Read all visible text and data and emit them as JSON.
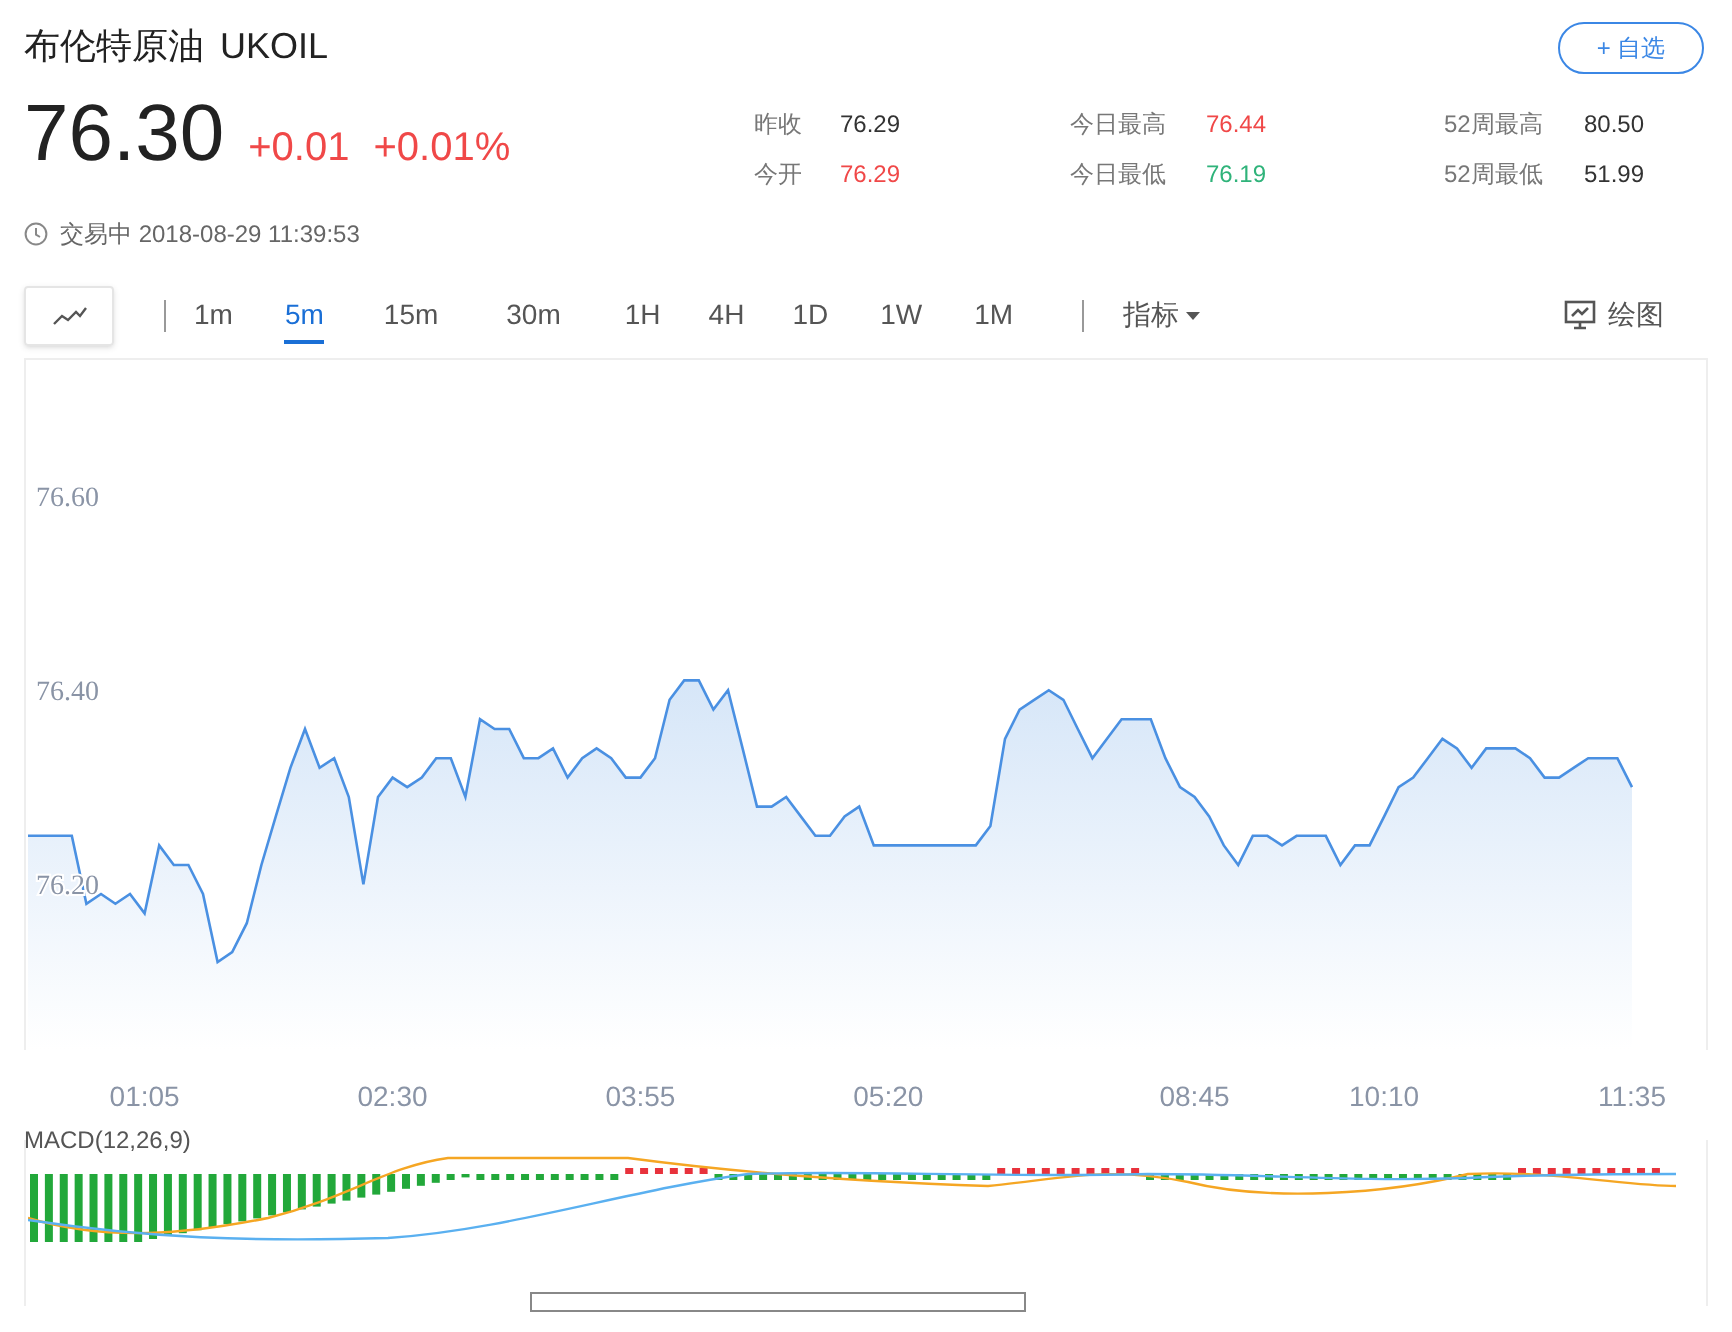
{
  "header": {
    "name": "布伦特原油",
    "symbol": "UKOIL",
    "watch_button": "+ 自选"
  },
  "quote": {
    "price": "76.30",
    "change": "+0.01",
    "change_pct": "+0.01%"
  },
  "stats": [
    [
      {
        "label": "昨收",
        "value": "76.29",
        "color": "#333333"
      },
      {
        "label": "今开",
        "value": "76.29",
        "color": "#f04848"
      }
    ],
    [
      {
        "label": "今日最高",
        "value": "76.44",
        "color": "#f04848"
      },
      {
        "label": "今日最低",
        "value": "76.19",
        "color": "#2fb37a"
      }
    ],
    [
      {
        "label": "52周最高",
        "value": "80.50",
        "color": "#333333"
      },
      {
        "label": "52周最低",
        "value": "51.99",
        "color": "#333333"
      }
    ]
  ],
  "status": {
    "state": "交易中",
    "time": "2018-08-29 11:39:53"
  },
  "toolbar": {
    "intervals": [
      {
        "label": "1m",
        "selected": false
      },
      {
        "label": "5m",
        "selected": true
      },
      {
        "label": "15m",
        "selected": false
      },
      {
        "label": "30m",
        "selected": false
      },
      {
        "label": "1H",
        "selected": false
      },
      {
        "label": "4H",
        "selected": false
      },
      {
        "label": "1D",
        "selected": false
      },
      {
        "label": "1W",
        "selected": false
      },
      {
        "label": "1M",
        "selected": false
      }
    ],
    "indicators": "指标",
    "draw": "绘图"
  },
  "chart": {
    "chart_data": {
      "type": "area",
      "ylim": [
        76.03,
        76.74
      ],
      "yticks": [
        {
          "value": 76.2,
          "label": "76.20"
        },
        {
          "value": 76.4,
          "label": "76.40"
        },
        {
          "value": 76.6,
          "label": "76.60"
        }
      ],
      "categories": [
        null,
        null,
        null,
        null,
        null,
        null,
        null,
        null,
        "01:05",
        null,
        null,
        null,
        null,
        null,
        null,
        null,
        null,
        null,
        null,
        null,
        null,
        null,
        null,
        null,
        null,
        "02:30",
        null,
        null,
        null,
        null,
        null,
        null,
        null,
        null,
        null,
        null,
        null,
        null,
        null,
        null,
        null,
        null,
        "03:55",
        null,
        null,
        null,
        null,
        null,
        null,
        null,
        null,
        null,
        null,
        null,
        null,
        null,
        null,
        null,
        null,
        "05:20",
        null,
        null,
        null,
        null,
        null,
        null,
        null,
        null,
        null,
        null,
        null,
        null,
        null,
        null,
        null,
        null,
        null,
        null,
        null,
        null,
        "08:45",
        null,
        null,
        null,
        null,
        null,
        null,
        null,
        null,
        null,
        null,
        null,
        null,
        "10:10",
        null,
        null,
        null,
        null,
        null,
        null,
        null,
        null,
        null,
        null,
        null,
        null,
        null,
        null,
        null,
        null,
        "11:35"
      ],
      "series": [
        {
          "color": "#4a90e2",
          "values": [
            76.25,
            76.25,
            76.25,
            76.25,
            76.18,
            76.19,
            76.18,
            76.19,
            76.17,
            76.24,
            76.22,
            76.22,
            76.19,
            76.12,
            76.13,
            76.16,
            76.22,
            76.27,
            76.32,
            76.36,
            76.32,
            76.33,
            76.29,
            76.2,
            76.29,
            76.31,
            76.3,
            76.31,
            76.33,
            76.33,
            76.29,
            76.37,
            76.36,
            76.36,
            76.33,
            76.33,
            76.34,
            76.31,
            76.33,
            76.34,
            76.33,
            76.31,
            76.31,
            76.33,
            76.39,
            76.41,
            76.41,
            76.38,
            76.4,
            76.34,
            76.28,
            76.28,
            76.29,
            76.27,
            76.25,
            76.25,
            76.27,
            76.28,
            76.24,
            76.24,
            76.24,
            76.24,
            76.24,
            76.24,
            76.24,
            76.24,
            76.26,
            76.35,
            76.38,
            76.39,
            76.4,
            76.39,
            76.36,
            76.33,
            76.35,
            76.37,
            76.37,
            76.37,
            76.33,
            76.3,
            76.29,
            76.27,
            76.24,
            76.22,
            76.25,
            76.25,
            76.24,
            76.25,
            76.25,
            76.25,
            76.22,
            76.24,
            76.24,
            76.27,
            76.3,
            76.31,
            76.33,
            76.35,
            76.34,
            76.32,
            76.34,
            76.34,
            76.34,
            76.33,
            76.31,
            76.31,
            76.32,
            76.33,
            76.33,
            76.33,
            76.3
          ]
        }
      ]
    }
  },
  "macd": {
    "label": "MACD(12,26,9)"
  }
}
